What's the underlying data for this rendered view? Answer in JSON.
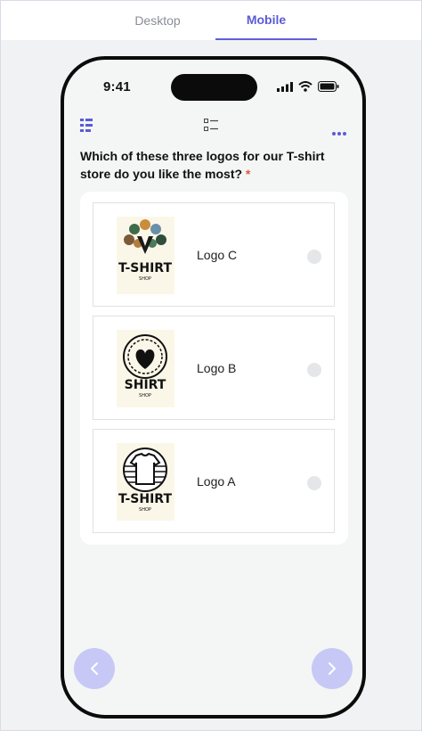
{
  "tabs": [
    {
      "label": "Desktop",
      "active": false
    },
    {
      "label": "Mobile",
      "active": true
    }
  ],
  "status_bar": {
    "time": "9:41"
  },
  "question": {
    "text": "Which of these three logos for our T-shirt store do you like the most?",
    "required_mark": "*"
  },
  "options": [
    {
      "label": "Logo C",
      "logo_text": "T-SHIRT",
      "logo_sub": "SHOP"
    },
    {
      "label": "Logo B",
      "logo_text": "SHIRT",
      "logo_sub": "SHOP"
    },
    {
      "label": "Logo A",
      "logo_text": "T-SHIRT",
      "logo_sub": "SHOP"
    }
  ],
  "icons": {
    "toolbar_left": "list-layout-icon",
    "toolbar_center": "checklist-icon",
    "toolbar_right": "more-dots-icon",
    "prev": "chevron-left-icon",
    "next": "chevron-right-icon"
  },
  "colors": {
    "accent": "#5b5bd6",
    "nav_button": "#c7c8f5",
    "required": "#e05a3a"
  }
}
